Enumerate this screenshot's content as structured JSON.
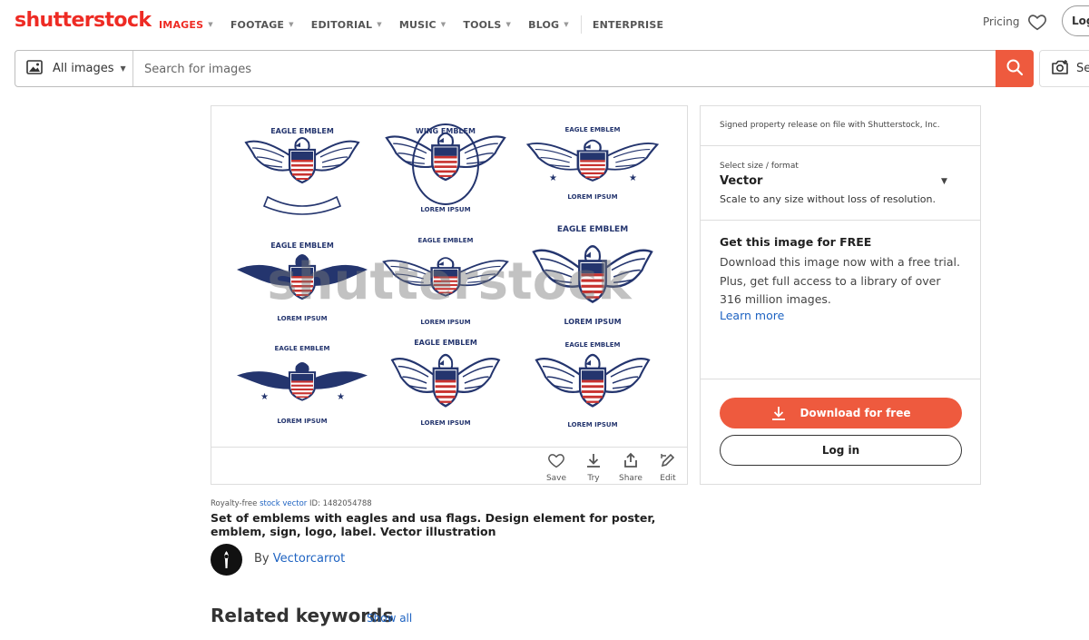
{
  "header": {
    "logo": "shutterstock",
    "nav": [
      {
        "label": "IMAGES",
        "active": true,
        "has_caret": true
      },
      {
        "label": "FOOTAGE",
        "active": false,
        "has_caret": true
      },
      {
        "label": "EDITORIAL",
        "active": false,
        "has_caret": true
      },
      {
        "label": "MUSIC",
        "active": false,
        "has_caret": true
      },
      {
        "label": "TOOLS",
        "active": false,
        "has_caret": true
      },
      {
        "label": "BLOG",
        "active": false,
        "has_caret": true
      }
    ],
    "enterprise": "ENTERPRISE",
    "pricing": "Pricing",
    "login": "Log"
  },
  "search": {
    "type_label": "All images",
    "placeholder": "Search for images",
    "visual_search_label": "Se"
  },
  "image": {
    "watermark": "shutterstock",
    "emblem_texts": [
      "EAGLE EMBLEM",
      "WING EMBLEM",
      "LOREM IPSUM"
    ],
    "toolbar": {
      "save": "Save",
      "try": "Try",
      "share": "Share",
      "edit": "Edit"
    }
  },
  "side": {
    "release": "Signed property release on file with Shutterstock, Inc.",
    "size_label": "Select size / format",
    "size_value": "Vector",
    "size_desc": "Scale to any size without loss of resolution.",
    "free_heading": "Get this image for FREE",
    "free_body": "Download this image now with a free trial. Plus, get full access to a library of over 316 million images.",
    "learn_more": "Learn more",
    "download_btn": "Download for free",
    "login_btn": "Log in"
  },
  "details": {
    "meta_prefix": "Royalty-free ",
    "meta_link": "stock vector",
    "meta_id": " ID: 1482054788",
    "title": "Set of emblems with eagles and usa flags. Design element for poster, emblem, sign, logo, label. Vector illustration",
    "by_label": "By ",
    "author": "Vectorcarrot"
  },
  "related": {
    "heading": "Related keywords",
    "show_all": "Show all"
  },
  "colors": {
    "brand": "#ee2b24",
    "cta": "#ee5a3e",
    "link": "#1e63c2",
    "navy": "#24356e",
    "flag_red": "#c8322f"
  }
}
